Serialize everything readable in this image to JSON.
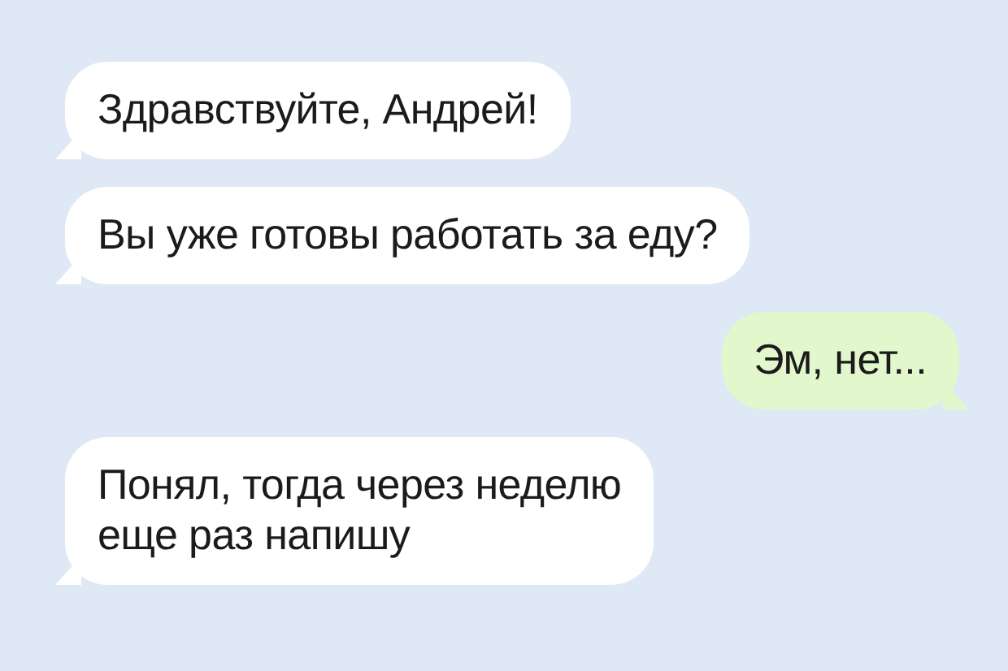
{
  "messages": [
    {
      "kind": "incoming",
      "lines": [
        "Здравствуйте, Андрей!"
      ]
    },
    {
      "kind": "incoming",
      "lines": [
        "Вы уже готовы работать за еду?"
      ]
    },
    {
      "kind": "outgoing",
      "lines": [
        "Эм, нет..."
      ]
    },
    {
      "kind": "incoming",
      "lines": [
        "Понял, тогда через неделю",
        "еще раз напишу"
      ]
    }
  ]
}
